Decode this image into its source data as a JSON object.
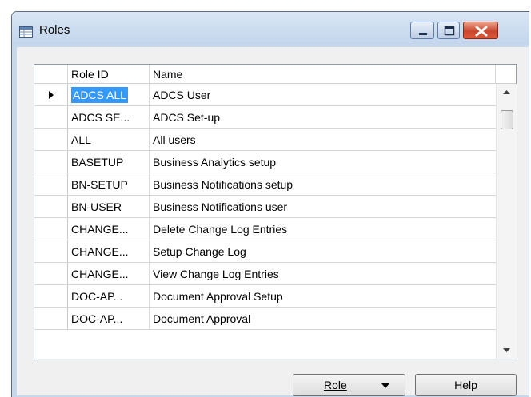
{
  "window": {
    "title": "Roles",
    "icon": "table-icon",
    "controls": [
      "minimize-icon",
      "maximize-icon",
      "close-icon"
    ]
  },
  "grid": {
    "columns": [
      "Role ID",
      "Name"
    ],
    "selected_row_index": 0,
    "rows": [
      {
        "role_id": "ADCS ALL",
        "name": "ADCS User"
      },
      {
        "role_id": "ADCS SE...",
        "name": "ADCS Set-up"
      },
      {
        "role_id": "ALL",
        "name": "All users"
      },
      {
        "role_id": "BASETUP",
        "name": "Business Analytics setup"
      },
      {
        "role_id": "BN-SETUP",
        "name": "Business Notifications setup"
      },
      {
        "role_id": "BN-USER",
        "name": "Business Notifications user"
      },
      {
        "role_id": "CHANGE...",
        "name": "Delete Change Log Entries"
      },
      {
        "role_id": "CHANGE...",
        "name": "Setup Change Log"
      },
      {
        "role_id": "CHANGE...",
        "name": "View Change Log Entries"
      },
      {
        "role_id": "DOC-AP...",
        "name": "Document Approval Setup"
      },
      {
        "role_id": "DOC-AP...",
        "name": "Document Approval"
      }
    ]
  },
  "buttons": {
    "role_label": "Role",
    "help_label": "Help"
  },
  "colors": {
    "selection": "#3399ff",
    "window_frame": "#c7d8ec",
    "close_button": "#c9462d"
  }
}
